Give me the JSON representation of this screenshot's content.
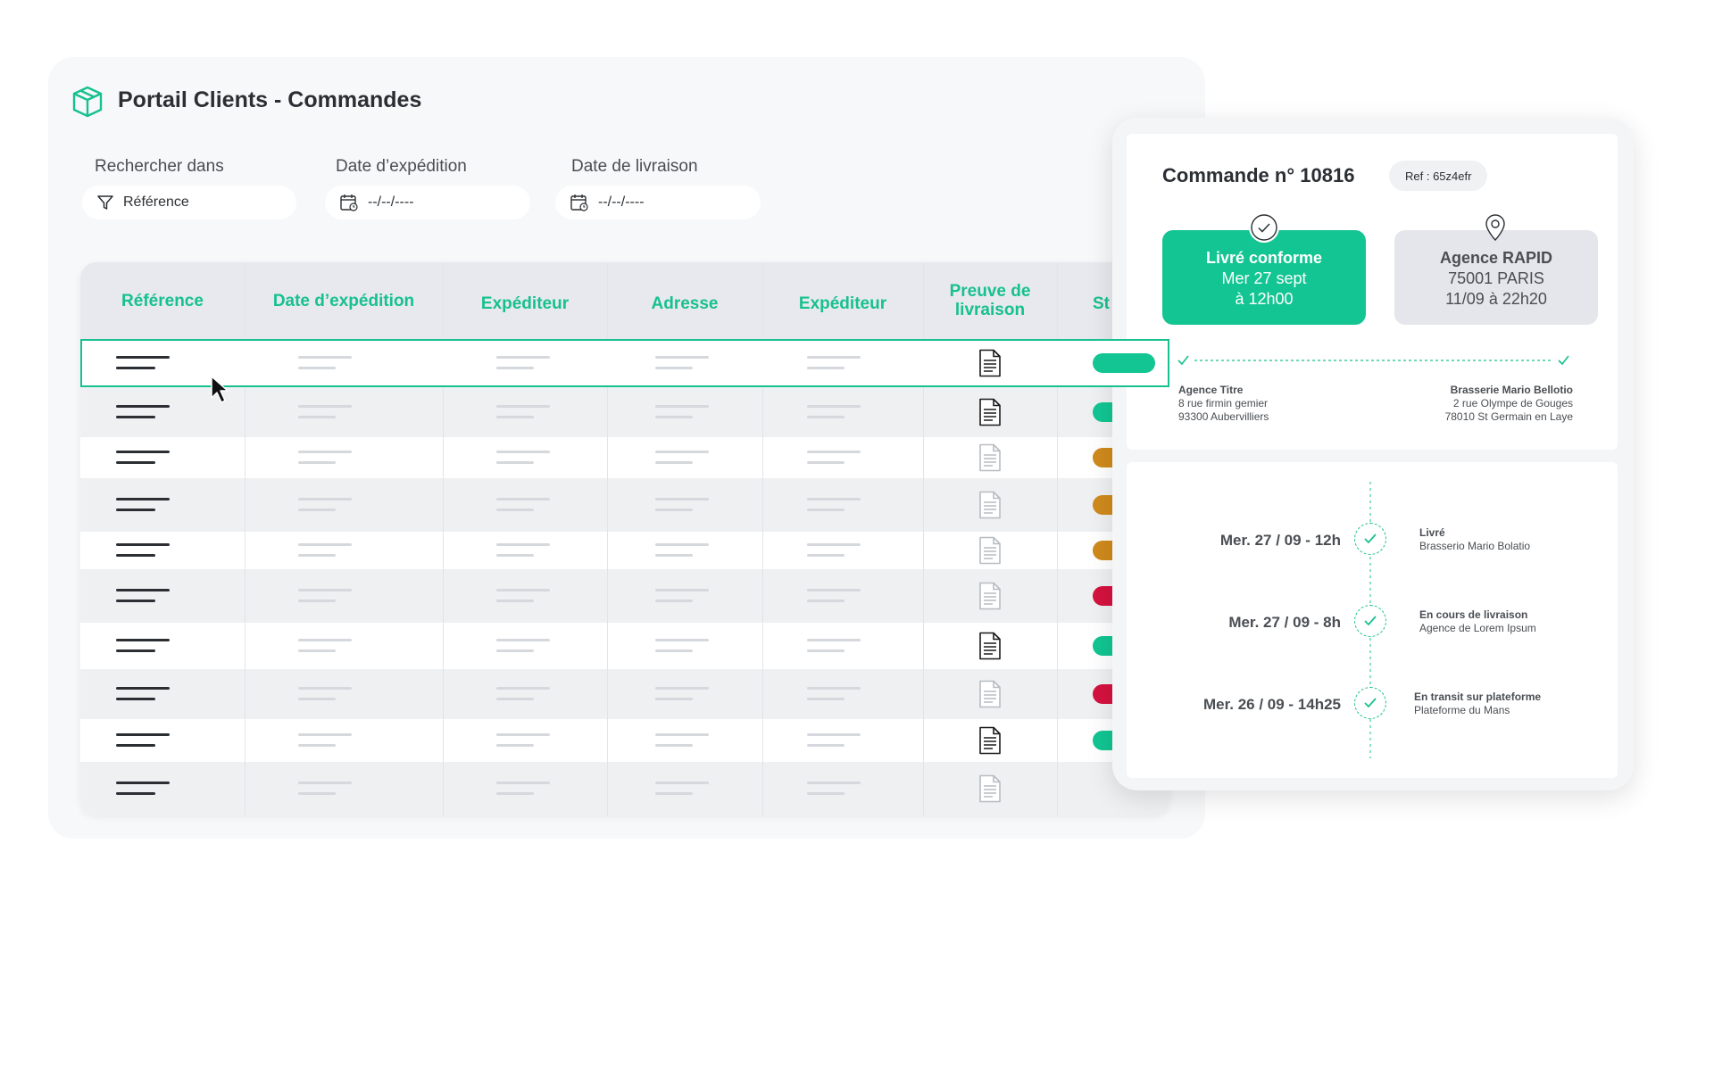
{
  "portal": {
    "title": "Portail Clients - Commandes",
    "filters": [
      {
        "label": "Rechercher dans",
        "value": "Référence",
        "icon": "filter-icon"
      },
      {
        "label": "Date d’expédition",
        "value": "--/--/----",
        "icon": "calendar-icon"
      },
      {
        "label": "Date de livraison",
        "value": "--/--/----",
        "icon": "calendar-icon"
      }
    ]
  },
  "table": {
    "columns": [
      {
        "label": "Référence"
      },
      {
        "label": "Date d’expédition"
      },
      {
        "label": "Expéditeur"
      },
      {
        "label": "Adresse"
      },
      {
        "label": "Expéditeur"
      },
      {
        "label": "Preuve de\nlivraison"
      },
      {
        "label": "St"
      }
    ],
    "rows": [
      {
        "proof": "available",
        "status": "#12c592"
      },
      {
        "proof": "available",
        "status": "#12c592"
      },
      {
        "proof": "pending",
        "status": "#cf8a1c"
      },
      {
        "proof": "pending",
        "status": "#cf8a1c"
      },
      {
        "proof": "pending",
        "status": "#cf8a1c"
      },
      {
        "proof": "pending",
        "status": "#d4123f"
      },
      {
        "proof": "available",
        "status": "#12c592"
      },
      {
        "proof": "pending",
        "status": "#d4123f"
      },
      {
        "proof": "available",
        "status": "#12c592"
      },
      {
        "proof": "pending",
        "status": ""
      }
    ]
  },
  "detail": {
    "order_title": "Commande n° 10816",
    "ref": "Ref : 65z4efr",
    "delivered_card": {
      "line1": "Livré conforme",
      "line2": "Mer 27 sept",
      "line3": "à 12h00"
    },
    "agency_card": {
      "line1": "Agence RAPID",
      "line2": "75001 PARIS",
      "line3": "11/09 à 22h20"
    },
    "origin": {
      "name": "Agence Titre",
      "street": "8 rue firmin gemier",
      "city": "93300 Aubervilliers"
    },
    "destination": {
      "name": "Brasserie Mario Bellotio",
      "street": "2 rue Olympe de Gouges",
      "city": "78010 St Germain en Laye"
    },
    "timeline": [
      {
        "date": "Mer. 27 / 09 - 12h",
        "status": "Livré",
        "place": "Brasserio Mario Bolatio"
      },
      {
        "date": "Mer. 27 / 09 - 8h",
        "status": "En cours de livraison",
        "place": "Agence de Lorem Ipsum"
      },
      {
        "date": "Mer. 26 / 09 - 14h25",
        "status": "En transit sur plateforme",
        "place": "Plateforme du Mans"
      }
    ]
  },
  "colors": {
    "accent": "#17c08f",
    "ok": "#12c592",
    "warning": "#cf8a1c",
    "error": "#d4123f"
  }
}
